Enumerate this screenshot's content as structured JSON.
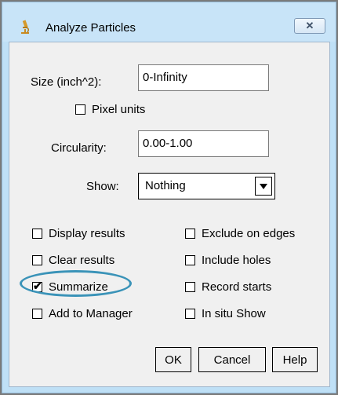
{
  "window": {
    "title": "Analyze Particles",
    "close_glyph": "✕",
    "app_icon": "microscope-icon"
  },
  "form": {
    "size": {
      "label": "Size (inch^2):",
      "value": "0-Infinity"
    },
    "pixel_units": {
      "label": "Pixel units",
      "checked": false
    },
    "circularity": {
      "label": "Circularity:",
      "value": "0.00-1.00"
    },
    "show": {
      "label": "Show:",
      "selected": "Nothing"
    }
  },
  "options": {
    "display_results": {
      "label": "Display results",
      "checked": false
    },
    "exclude_on_edges": {
      "label": "Exclude on edges",
      "checked": false
    },
    "clear_results": {
      "label": "Clear results",
      "checked": false
    },
    "include_holes": {
      "label": "Include holes",
      "checked": false
    },
    "summarize": {
      "label": "Summarize",
      "checked": true,
      "highlighted": true
    },
    "record_starts": {
      "label": "Record starts",
      "checked": false
    },
    "add_to_manager": {
      "label": "Add to Manager",
      "checked": false
    },
    "in_situ_show": {
      "label": "In situ Show",
      "checked": false
    }
  },
  "buttons": {
    "ok": "OK",
    "cancel": "Cancel",
    "help": "Help"
  },
  "colors": {
    "highlight": "#3a93b8",
    "frame": "#bfe0f6",
    "client": "#f0f0f0"
  },
  "glyphs": {
    "check": "✔",
    "dropdown": "▼"
  }
}
